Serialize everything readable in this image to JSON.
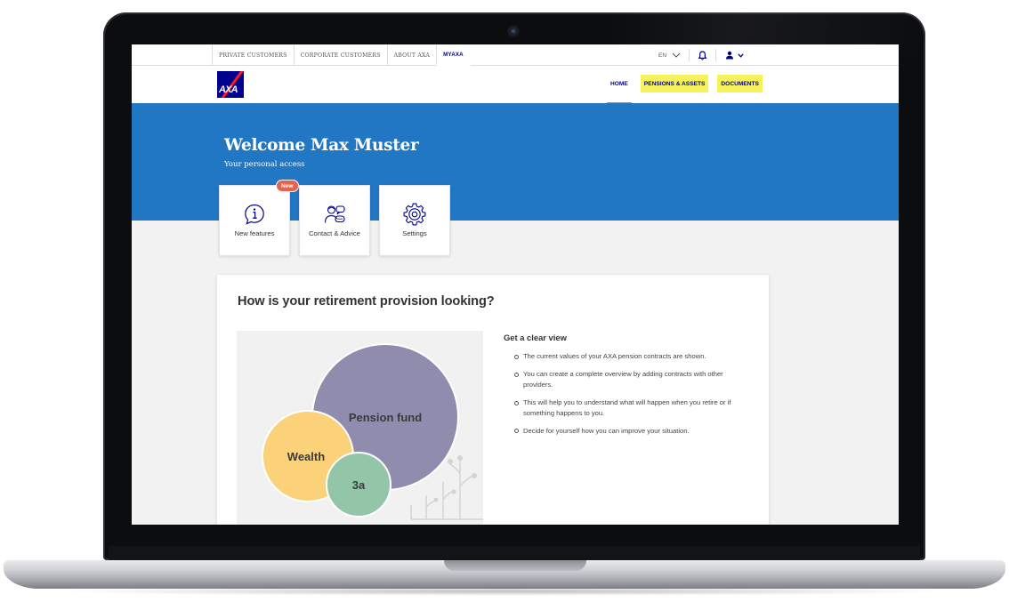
{
  "topbar": {
    "tabs": [
      "PRIVATE CUSTOMERS",
      "CORPORATE CUSTOMERS",
      "ABOUT AXA",
      "MYAXA"
    ],
    "language": "EN"
  },
  "header": {
    "logo_text": "AXA",
    "nav": [
      "HOME",
      "PENSIONS & ASSETS",
      "DOCUMENTS"
    ]
  },
  "hero": {
    "title": "Welcome Max Muster",
    "subtitle": "Your personal access"
  },
  "tiles": [
    {
      "label": "New features",
      "badge": "New",
      "icon": "info-bubble-icon"
    },
    {
      "label": "Contact & Advice",
      "icon": "advisor-icon"
    },
    {
      "label": "Settings",
      "icon": "gear-icon"
    }
  ],
  "retirement": {
    "heading": "How is your retirement provision looking?",
    "bubbles": [
      "Pension fund",
      "Wealth",
      "3a"
    ],
    "info_title": "Get a clear view",
    "bullets": [
      "The current values of your AXA pension contracts are shown.",
      "You can create a complete overview by adding contracts with other providers.",
      "This will help you to understand what will happen when you retire or if something happens to you.",
      "Decide for yourself how you can improve your situation."
    ]
  },
  "colors": {
    "axa_blue": "#00008f",
    "hero_blue": "#2277c4",
    "highlight_yellow": "#f6f25c",
    "badge_red": "#e8614f",
    "pension_bubble": "#8f8cae",
    "wealth_bubble": "#fbd17a",
    "bubble_3a": "#93c5a9"
  }
}
